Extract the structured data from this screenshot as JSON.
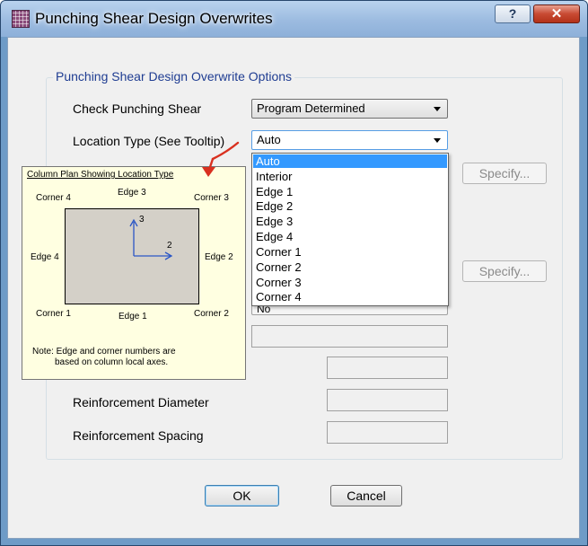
{
  "window": {
    "title": "Punching Shear Design Overwrites",
    "help_glyph": "?",
    "close_glyph": "✕"
  },
  "group": {
    "title": "Punching Shear Design Overwrite Options"
  },
  "form": {
    "check_punching_shear": {
      "label": "Check Punching Shear",
      "value": "Program Determined"
    },
    "location_type": {
      "label": "Location Type  (See Tooltip)",
      "value": "Auto"
    },
    "specify_label": "Specify...",
    "hidden_combo_value": "No",
    "reinforcement_diameter": {
      "label": "Reinforcement Diameter"
    },
    "reinforcement_spacing": {
      "label": "Reinforcement Spacing"
    }
  },
  "dropdown": {
    "options": [
      "Auto",
      "Interior",
      "Edge 1",
      "Edge 2",
      "Edge 3",
      "Edge 4",
      "Corner 1",
      "Corner 2",
      "Corner 3",
      "Corner 4"
    ],
    "selected": "Auto"
  },
  "tooltip": {
    "title": "Column Plan Showing Location Type",
    "corner4": "Corner 4",
    "edge3": "Edge 3",
    "corner3": "Corner 3",
    "edge4": "Edge 4",
    "edge2": "Edge 2",
    "corner1": "Corner 1",
    "edge1": "Edge 1",
    "corner2": "Corner 2",
    "axis3": "3",
    "axis2": "2",
    "note_line1": "Note: Edge and corner numbers are",
    "note_line2": "based on column local axes."
  },
  "buttons": {
    "ok": "OK",
    "cancel": "Cancel"
  },
  "colors": {
    "title_bar": "#9cbbe0",
    "selection": "#3399ff",
    "tooltip_bg": "#ffffe1",
    "arrow": "#d9301f",
    "group_title": "#1f3d92"
  },
  "icons": [
    "app-icon",
    "help-icon",
    "close-icon",
    "chevron-down-icon",
    "tooltip-pointer-arrow-icon"
  ]
}
